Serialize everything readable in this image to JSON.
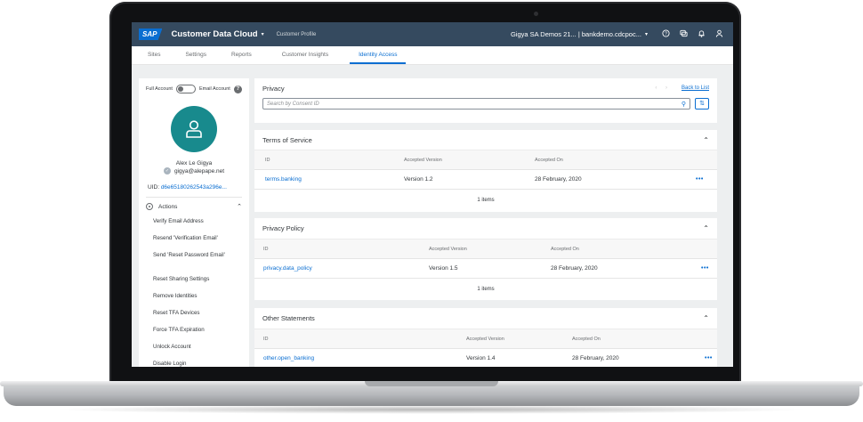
{
  "shell": {
    "logo": "SAP",
    "product": "Customer Data Cloud",
    "product_caret": "▾",
    "subtitle": "Customer Profile",
    "tenant": "Gigya SA Demos 21... | bankdemo.cdcpoc...",
    "tenant_caret": "▾",
    "icons": [
      "help-icon",
      "feedback-icon",
      "notification-icon",
      "user-icon"
    ]
  },
  "tabs": [
    {
      "label": "Sites",
      "active": false
    },
    {
      "label": "Settings",
      "active": false
    },
    {
      "label": "Reports",
      "active": false
    },
    {
      "label": "Customer Insights",
      "active": false
    },
    {
      "label": "Identity Access",
      "active": true
    }
  ],
  "profile": {
    "toggle_left": "Full Account",
    "toggle_right": "Email Account",
    "help_glyph": "?",
    "name": "Alex Le Gigya",
    "email": "gigya@alepape.net",
    "uid_label": "UID:",
    "uid_value": "d6e65180262543a296e...",
    "actions_label": "Actions",
    "actions_chevron": "⌃",
    "actions": [
      "Verify Email Address",
      "Resend 'Verification Email'",
      "Send 'Reset Password Email'",
      "Reset Sharing Settings",
      "Remove Identities",
      "Reset TFA Devices",
      "Force TFA Expiration",
      "Unlock Account",
      "Disable Login"
    ]
  },
  "privacy": {
    "title": "Privacy",
    "nav_arrows": "‹ ›",
    "back_link": "Back to List",
    "search_placeholder": "Search by Consent ID",
    "search_glyph": "⚲",
    "filter_glyph": "⇅"
  },
  "sections": [
    {
      "title": "Terms of Service",
      "collapse_glyph": "⌃",
      "columns": [
        "ID",
        "Accepted Version",
        "Accepted On"
      ],
      "rows": [
        {
          "id": "terms.banking",
          "version": "Version 1.2",
          "date": "28 February, 2020",
          "more": "•••"
        }
      ],
      "count": "1 items"
    },
    {
      "title": "Privacy Policy",
      "collapse_glyph": "⌃",
      "columns": [
        "ID",
        "Accepted Version",
        "Accepted On"
      ],
      "rows": [
        {
          "id": "privacy.data_policy",
          "version": "Version 1.5",
          "date": "28 February, 2020",
          "more": "•••"
        }
      ],
      "count": "1 items"
    },
    {
      "title": "Other Statements",
      "collapse_glyph": "⌃",
      "columns": [
        "ID",
        "Accepted Version",
        "Accepted On"
      ],
      "rows": [
        {
          "id": "other.open_banking",
          "version": "Version 1.4",
          "date": "28 February, 2020",
          "more": "•••"
        }
      ]
    }
  ],
  "colors": {
    "shell": "#354a5f",
    "accent": "#0a6ed1",
    "avatar": "#188a8d",
    "background": "#edeff0"
  }
}
